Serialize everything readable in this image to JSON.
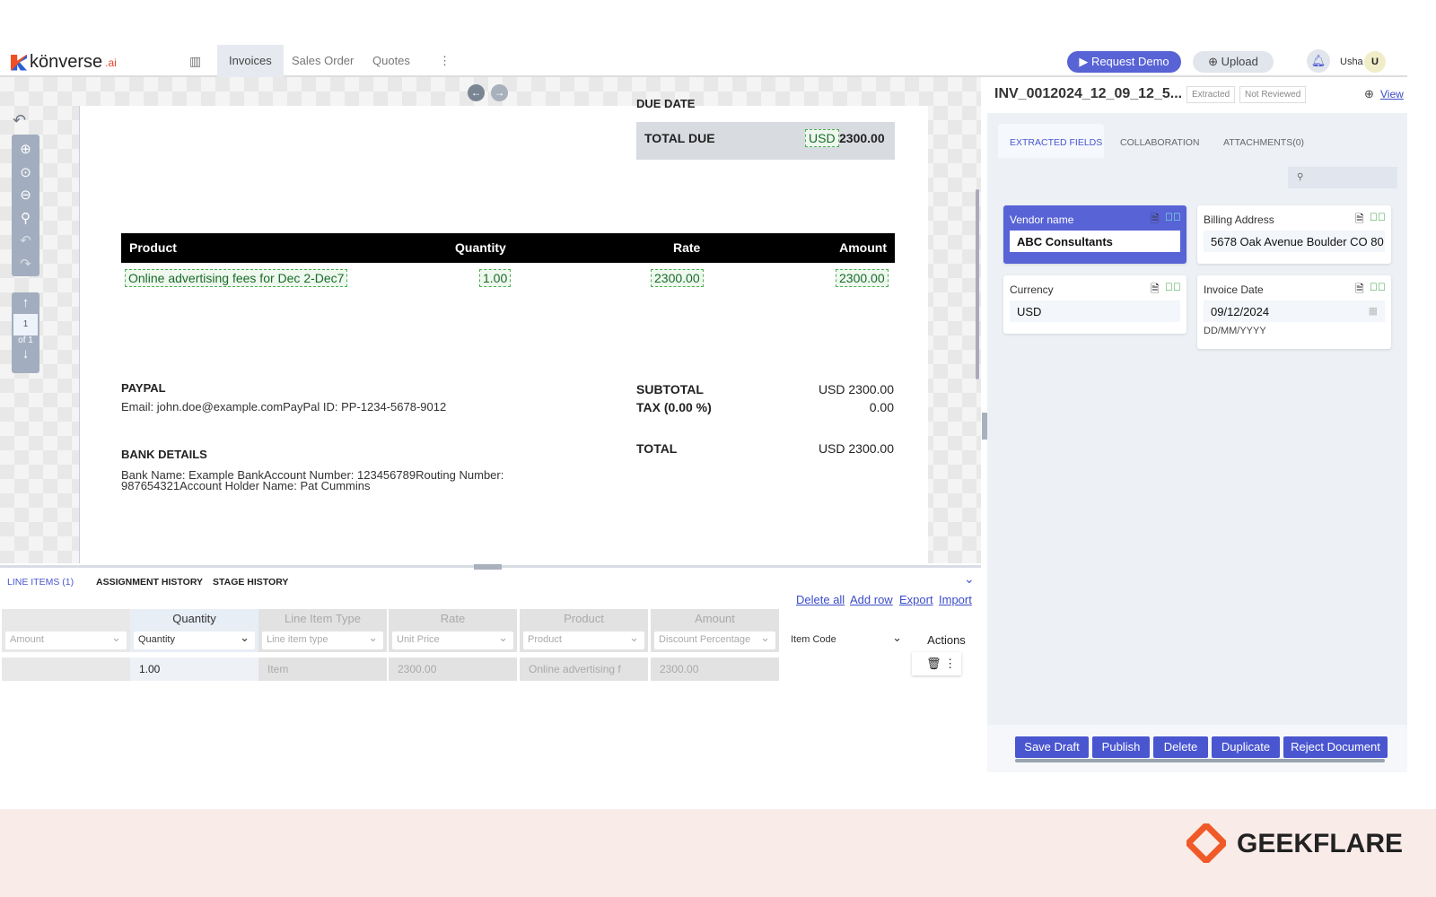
{
  "nav": {
    "brand": "könverse",
    "brand_suffix": ".ai",
    "items": [
      {
        "label": "Invoices",
        "active": true
      },
      {
        "label": "Sales Order"
      },
      {
        "label": "Quotes"
      }
    ],
    "request_demo": "Request Demo",
    "upload": "Upload",
    "user": "Usha",
    "avatar": "U"
  },
  "document": {
    "due_date_label": "DUE DATE",
    "total_due_label": "TOTAL DUE",
    "total_due_currency": "USD",
    "total_due_value": "2300.00",
    "table_headers": [
      "Product",
      "Quantity",
      "Rate",
      "Amount"
    ],
    "row": {
      "product": "Online advertising fees for Dec 2-Dec7",
      "quantity": "1.00",
      "rate": "2300.00",
      "amount": "2300.00"
    },
    "paypal_title": "PAYPAL",
    "paypal_text": "Email: john.doe@example.comPayPal ID: PP-1234-5678-9012",
    "bank_title": "BANK DETAILS",
    "bank_text": "Bank Name: Example BankAccount Number: 123456789Routing Number: 987654321Account Holder Name: Pat Cummins",
    "subtotal_label": "SUBTOTAL",
    "subtotal": "USD 2300.00",
    "tax_label": "TAX (0.00 %)",
    "tax": "0.00",
    "total_label": "TOTAL",
    "total": "USD 2300.00"
  },
  "pager": {
    "page": "1",
    "of": "of 1"
  },
  "bottom": {
    "tabs": [
      "LINE ITEMS (1)",
      "ASSIGNMENT HISTORY",
      "STAGE HISTORY"
    ],
    "links": [
      "Delete all",
      "Add row",
      "Export",
      "Import"
    ],
    "columns": [
      {
        "head": "",
        "select": "Amount",
        "cell": ""
      },
      {
        "head": "Quantity",
        "select": "Quantity",
        "cell": "1.00"
      },
      {
        "head": "Line Item Type",
        "select": "Line item type",
        "cell": "Item"
      },
      {
        "head": "Rate",
        "select": "Unit Price",
        "cell": "2300.00"
      },
      {
        "head": "Product",
        "select": "Product",
        "cell": "Online advertising f"
      },
      {
        "head": "Amount",
        "select": "Discount Percentage",
        "cell": "2300.00"
      },
      {
        "head": "",
        "select": "Item Code",
        "cell": ""
      }
    ],
    "actions_label": "Actions"
  },
  "right": {
    "title": "INV_0012024_12_09_12_5...",
    "badges": [
      "Extracted",
      "Not Reviewed"
    ],
    "view": "View",
    "tabs": [
      "EXTRACTED FIELDS",
      "COLLABORATION",
      "ATTACHMENTS(0)"
    ],
    "fields": {
      "vendor": {
        "label": "Vendor name",
        "value": "ABC Consultants"
      },
      "billing": {
        "label": "Billing Address",
        "value": "5678 Oak Avenue Boulder CO 80"
      },
      "currency": {
        "label": "Currency",
        "value": "USD"
      },
      "date": {
        "label": "Invoice Date",
        "value": "09/12/2024",
        "format": "DD/MM/YYYY"
      }
    },
    "actions": [
      "Save Draft",
      "Publish",
      "Delete",
      "Duplicate",
      "Reject Document"
    ]
  },
  "footer": {
    "brand": "GEEKFLARE"
  },
  "colors": {
    "accent": "#5863d6",
    "success": "#2e9e3e"
  }
}
